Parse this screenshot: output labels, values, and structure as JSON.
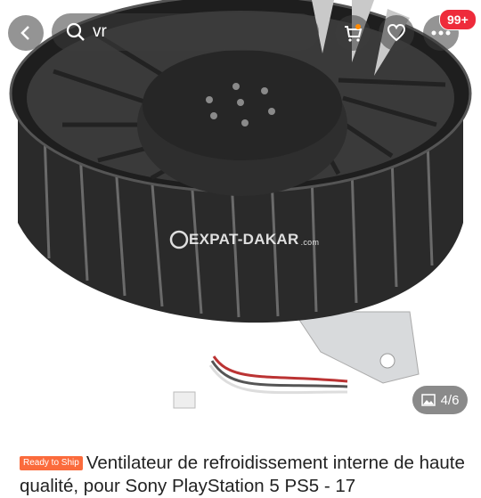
{
  "search": {
    "query": "vr"
  },
  "header": {
    "badge": "99+"
  },
  "image": {
    "watermark": "EXPAT-DAKAR",
    "watermark_suffix": ".com",
    "counter": "4/6"
  },
  "product": {
    "tag": "Ready to Ship",
    "title": "Ventilateur de refroidissement interne de haute qualité, pour Sony PlayStation 5 PS5 - 17"
  },
  "colors": {
    "badge": "#ee2b3b",
    "tag": "#fb6b3c",
    "overlay": "#3c3c3c"
  },
  "icons": [
    "back-arrow-icon",
    "search-icon",
    "cart-icon",
    "heart-icon",
    "more-icon",
    "image-icon"
  ]
}
